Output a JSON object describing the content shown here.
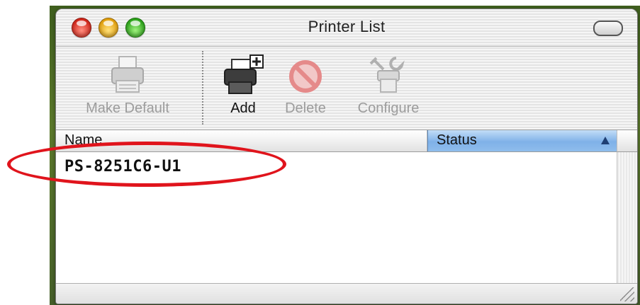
{
  "window": {
    "title": "Printer List"
  },
  "toolbar": {
    "items": [
      {
        "label": "Make Default",
        "enabled": false,
        "icon": "printer-icon"
      },
      {
        "label": "Add",
        "enabled": true,
        "icon": "add-printer-icon"
      },
      {
        "label": "Delete",
        "enabled": false,
        "icon": "delete-icon"
      },
      {
        "label": "Configure",
        "enabled": false,
        "icon": "configure-icon"
      }
    ]
  },
  "list": {
    "columns": [
      {
        "label": "Name"
      },
      {
        "label": "Status",
        "sorted": true,
        "sort_direction": "ascending"
      }
    ],
    "rows": [
      {
        "name": "PS-8251C6-U1",
        "status": ""
      }
    ]
  },
  "colors": {
    "annotation": "#e0141c",
    "close_button": "#d2281c",
    "minimize_button": "#e3a10f",
    "zoom_button": "#2ea51c",
    "sorted_header": "#7fb1e8"
  }
}
